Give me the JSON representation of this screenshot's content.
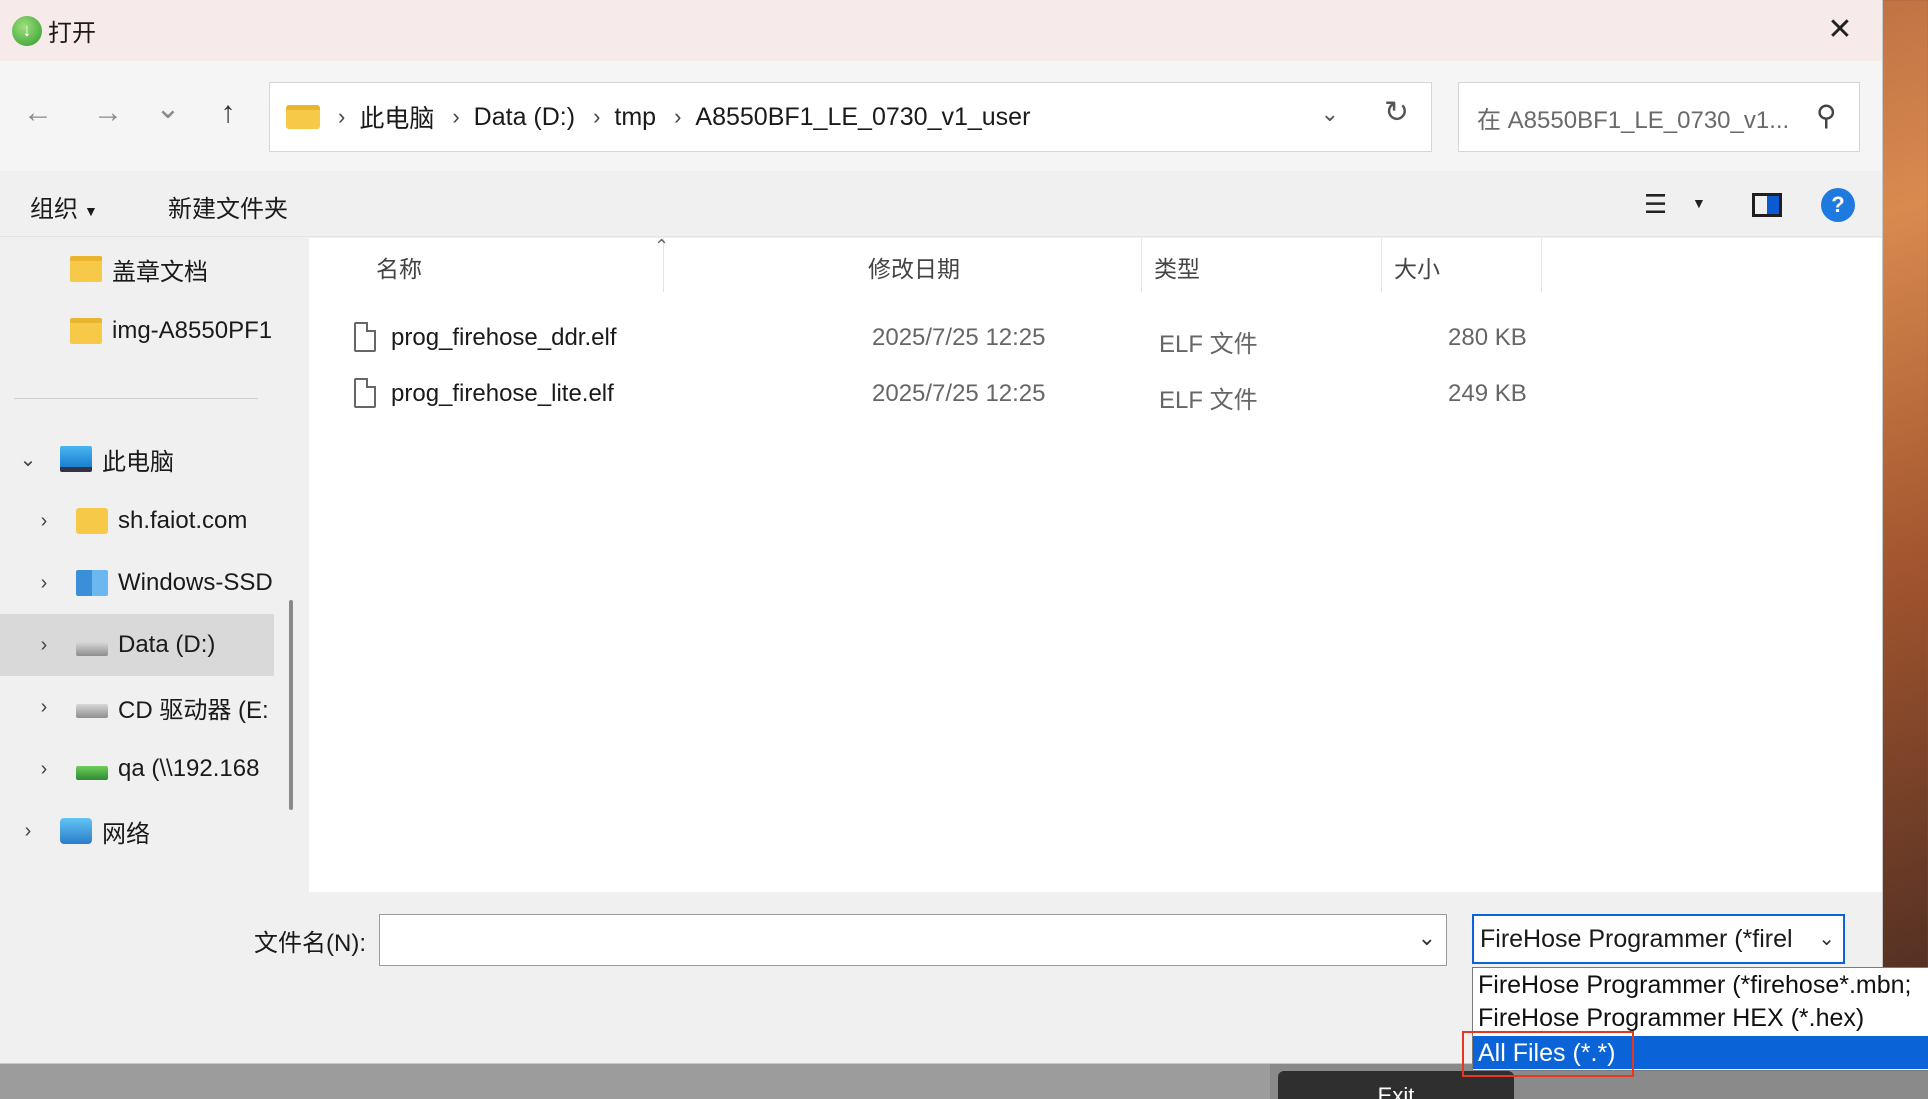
{
  "window": {
    "title": "打开",
    "close_label": "✕"
  },
  "nav": {
    "back_icon": "←",
    "forward_icon": "→",
    "recent_icon": "⌄",
    "up_icon": "↑",
    "breadcrumbs": [
      "此电脑",
      "Data (D:)",
      "tmp",
      "A8550BF1_LE_0730_v1_user"
    ],
    "separator": "›",
    "search_placeholder": "在 A8550BF1_LE_0730_v1..."
  },
  "toolbar": {
    "organize": "组织",
    "new_folder": "新建文件夹"
  },
  "sidebar": {
    "items": [
      {
        "label": "盖章文档",
        "icon": "folder-icon"
      },
      {
        "label": "img-A8550PF1",
        "icon": "folder-icon"
      },
      {
        "label": "此电脑",
        "icon": "pc-icon",
        "chevron": "⌄"
      },
      {
        "label": "sh.faiot.com",
        "icon": "share-icon",
        "chevron": "›"
      },
      {
        "label": "Windows-SSD",
        "icon": "windows-drive-icon",
        "chevron": "›"
      },
      {
        "label": "Data (D:)",
        "icon": "drive-icon",
        "chevron": "›"
      },
      {
        "label": "CD 驱动器 (E:",
        "icon": "cd-drive-icon",
        "chevron": "›"
      },
      {
        "label": "qa (\\\\192.168",
        "icon": "network-drive-icon",
        "chevron": "›"
      },
      {
        "label": "网络",
        "icon": "network-icon",
        "chevron": "›"
      }
    ]
  },
  "filelist": {
    "columns": [
      "名称",
      "修改日期",
      "类型",
      "大小"
    ],
    "rows": [
      {
        "name": "prog_firehose_ddr.elf",
        "date": "2025/7/25 12:25",
        "type": "ELF 文件",
        "size": "280 KB"
      },
      {
        "name": "prog_firehose_lite.elf",
        "date": "2025/7/25 12:25",
        "type": "ELF 文件",
        "size": "249 KB"
      }
    ]
  },
  "bottom": {
    "filename_label": "文件名(N):",
    "filename_value": "",
    "filter_selected": "FireHose Programmer (*firel",
    "filter_options": [
      "FireHose Programmer (*firehose*.mbn;",
      "FireHose Programmer HEX (*.hex)",
      "All Files (*.*)"
    ],
    "highlighted_option": "All Files (*.*)"
  },
  "background": {
    "exit_label": "Exit"
  },
  "colors": {
    "accent": "#0a64d8",
    "highlight_box": "#e8361f",
    "titlebar": "#f6ebea"
  }
}
